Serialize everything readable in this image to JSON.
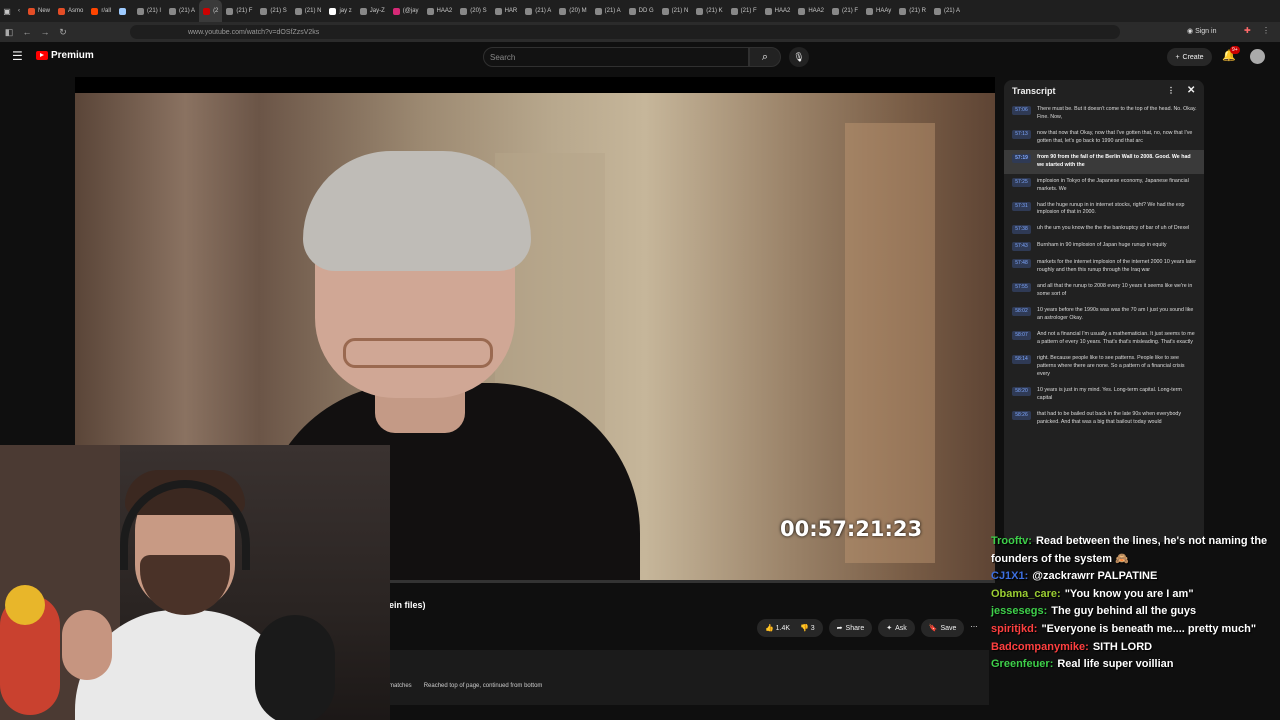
{
  "browser": {
    "tabs": [
      {
        "label": "New",
        "color": "#e44d26"
      },
      {
        "label": "Asmo",
        "color": "#e44d26"
      },
      {
        "label": "r/all",
        "color": "#ff4500"
      },
      {
        "label": "",
        "color": "#9ecbff"
      },
      {
        "label": "(21) I",
        "color": "#888888"
      },
      {
        "label": "(21) A",
        "color": "#888888"
      },
      {
        "label": "(2",
        "color": "#cc0000",
        "active": true
      },
      {
        "label": "(21) F",
        "color": "#888888"
      },
      {
        "label": "(21) S",
        "color": "#888888"
      },
      {
        "label": "(21) N",
        "color": "#888888"
      },
      {
        "label": "jay z",
        "color": "#ffffff"
      },
      {
        "label": "Jay-Z",
        "color": "#888888"
      },
      {
        "label": "(@jay",
        "color": "#d62976"
      },
      {
        "label": "HAA2",
        "color": "#888888"
      },
      {
        "label": "(20) S",
        "color": "#888888"
      },
      {
        "label": "HAR",
        "color": "#888888"
      },
      {
        "label": "(21) A",
        "color": "#888888"
      },
      {
        "label": "(20) M",
        "color": "#888888"
      },
      {
        "label": "(21) A",
        "color": "#888888"
      },
      {
        "label": "DD G",
        "color": "#888888"
      },
      {
        "label": "(21) N",
        "color": "#888888"
      },
      {
        "label": "(21) K",
        "color": "#888888"
      },
      {
        "label": "(21) F",
        "color": "#888888"
      },
      {
        "label": "HAA2",
        "color": "#888888"
      },
      {
        "label": "HAA2",
        "color": "#888888"
      },
      {
        "label": "(21) F",
        "color": "#888888"
      },
      {
        "label": "HAAy",
        "color": "#888888"
      },
      {
        "label": "(21) R",
        "color": "#888888"
      },
      {
        "label": "(21) A",
        "color": "#888888"
      }
    ],
    "url": "www.youtube.com/watch?v=dOSfZzsV2ks",
    "signin": "Sign in"
  },
  "youtube": {
    "logo": "Premium",
    "search_placeholder": "Search",
    "create": "Create",
    "notifications": "9+",
    "video_timecode": "00:57:21:23",
    "title_fragment": "ein files)",
    "likes": "1.4K",
    "dislikes": "3",
    "share": "Share",
    "ask": "Ask",
    "save": "Save",
    "find_matches": "matches",
    "find_status": "Reached top of page, continued from bottom"
  },
  "transcript": {
    "title": "Transcript",
    "segments": [
      {
        "t": "57:06",
        "text": "There must be. But it doesn't come to the top of the head. No. Okay. Fine. Now,"
      },
      {
        "t": "57:13",
        "text": "now that now that Okay, now that I've gotten that, no, now that I've gotten that, let's go back to 1990 and that arc"
      },
      {
        "t": "57:19",
        "text": "from 90 from the fall of the Berlin Wall to 2008. Good. We had we started with the",
        "active": true
      },
      {
        "t": "57:25",
        "text": "implosion in Tokyo of the Japanese economy, Japanese financial markets. We"
      },
      {
        "t": "57:31",
        "text": "had the huge runup in in internet stocks, right? We had the exp implosion of that in 2000."
      },
      {
        "t": "57:38",
        "text": "uh the um you know the the the bankruptcy of bar of uh of Drexel"
      },
      {
        "t": "57:43",
        "text": "Burnham in 90 implosion of Japan huge runup in equity"
      },
      {
        "t": "57:48",
        "text": "markets for the internet implosion of the internet 2000 10 years later roughly and then this runup through the Iraq war"
      },
      {
        "t": "57:55",
        "text": "and all that the runup to 2008 every 10 years it seems like we're in some sort of"
      },
      {
        "t": "58:02",
        "text": "10 years before the 1990s was was the 70 am I just you sound like an astrologer Okay."
      },
      {
        "t": "58:07",
        "text": "And not a financial I'm usually a mathematician. It just seems to me a pattern of every 10 years. That's that's misleading. That's exactly"
      },
      {
        "t": "58:14",
        "text": "right. Because people like to see patterns. People like to see patterns where there are none. So a pattern of a financial crisis every"
      },
      {
        "t": "58:20",
        "text": "10 years is just in my mind. Yes. Long-term capital. Long-term capital"
      },
      {
        "t": "58:26",
        "text": "that had to be bailed out back in the late 90s when everybody panicked. And that was a big that bailout today would"
      }
    ]
  },
  "chat": [
    {
      "user": "Trooftv:",
      "color": "#3ecf4a",
      "msg": "Read between the lines, he's not naming the founders of the system 🙈"
    },
    {
      "user": "CJ1X1:",
      "color": "#3d6fe0",
      "msg": "@zackrawrr PALPATINE"
    },
    {
      "user": "Obama_care:",
      "color": "#9acd32",
      "msg": "\"You know you are I am\""
    },
    {
      "user": "jessesegs:",
      "color": "#3ecf4a",
      "msg": "The guy behind all the guys"
    },
    {
      "user": "spiritjkd:",
      "color": "#ff4040",
      "msg": "\"Everyone is beneath me.... pretty much\""
    },
    {
      "user": "Badcompanymike:",
      "color": "#ff4040",
      "msg": "SITH LORD"
    },
    {
      "user": "Greenfeuer:",
      "color": "#3ecf4a",
      "msg": "Real life super voillian"
    }
  ]
}
